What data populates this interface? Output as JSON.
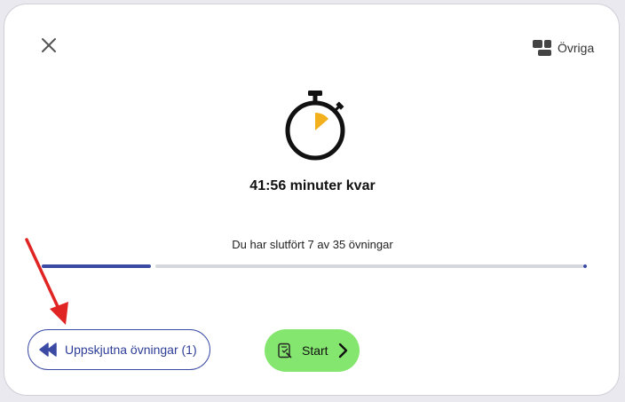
{
  "header": {
    "close_icon": "close-icon",
    "other_label": "Övriga",
    "other_icon": "layout-icon"
  },
  "timer": {
    "icon": "stopwatch-icon",
    "time_left_label": "41:56 minuter kvar"
  },
  "progress": {
    "label": "Du har slutfört 7 av 35 övningar",
    "completed": 7,
    "total": 35,
    "fill_color": "#3b4ba3",
    "track_color": "#d5d6de"
  },
  "actions": {
    "postponed_label": "Uppskjutna övningar (1)",
    "postponed_icon": "rewind-icon",
    "start_label": "Start",
    "start_icon": "exercise-icon",
    "start_chevron": "chevron-right-icon",
    "start_color": "#84e66e"
  },
  "annotation": {
    "arrow_color": "#e02424"
  }
}
